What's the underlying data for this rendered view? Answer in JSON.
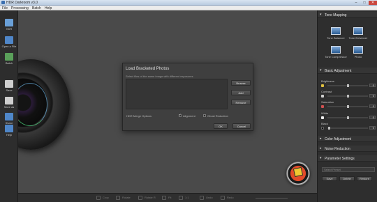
{
  "window": {
    "title": "HDR Darkroom v3.0",
    "min_btn": "–",
    "max_btn": "□",
    "close_btn": "✕"
  },
  "menu": [
    "File",
    "Processing",
    "Batch",
    "Help"
  ],
  "toolbar": [
    {
      "label": "HDR",
      "icon": "hdr-icon",
      "color": "#6aa0d8"
    },
    {
      "label": "Open a File",
      "icon": "folder-icon",
      "color": "#4f86c8"
    },
    {
      "label": "Batch",
      "icon": "batch-icon",
      "color": "#5aa05a"
    },
    {
      "label": "Save",
      "icon": "save-icon",
      "color": "#cfcfcf"
    },
    {
      "label": "Save as",
      "icon": "save-as-icon",
      "color": "#cfcfcf"
    },
    {
      "label": "Share",
      "icon": "share-icon",
      "color": "#4f86c8"
    },
    {
      "label": "Help",
      "icon": "help-icon",
      "color": "#4f86c8"
    }
  ],
  "dialog": {
    "title": "Load Bracketed Photos",
    "hint": "Select files of the same image with different exposures",
    "browse": "Browse",
    "add": "Add",
    "remove": "Remove",
    "merge_label": "HDR Merge Options",
    "aligned": "Alignment",
    "aligned_checked": true,
    "ghost": "Ghost Reduction",
    "ghost_checked": false,
    "ok": "OK",
    "cancel": "Cancel"
  },
  "panel": {
    "tone_mapping": "Tone Mapping",
    "presets": [
      "Tone Balancer",
      "Tone Enhancer",
      "Tone Compressor",
      "Photo"
    ],
    "basic_adjustment": "Basic Adjustment",
    "sliders": [
      {
        "label": "Brightness",
        "value": "0",
        "level": 0.5,
        "icon_color": "#e0c040"
      },
      {
        "label": "Contrast",
        "value": "0",
        "level": 0.5,
        "icon_color": "#d0d0d0"
      },
      {
        "label": "Saturation",
        "value": "0",
        "level": 0.5,
        "icon_color": "#d05050"
      },
      {
        "label": "White",
        "value": "0",
        "level": 0.5,
        "icon_color": "#eeeeee"
      },
      {
        "label": "Black",
        "value": "0",
        "level": 0.0,
        "icon_color": "#111111"
      }
    ],
    "color_adjustment": "Color Adjustment",
    "noise_reduction": "Noise Reduction",
    "parameter_settings": "Parameter Settings",
    "param_dropdown": "Select Preset",
    "param_buttons": [
      "Save",
      "Delete",
      "Restore"
    ]
  },
  "bottombar": [
    "Crop",
    "Rotate",
    "Rotate R",
    "Fit",
    "1:1",
    "Undo",
    "Redo"
  ]
}
